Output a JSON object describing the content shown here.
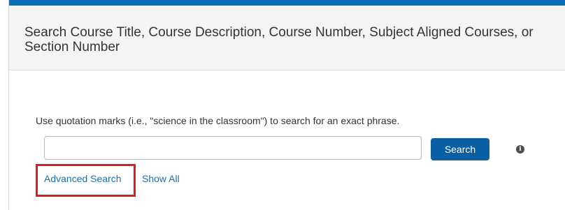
{
  "header": {
    "title": "Search Course Title, Course Description, Course Number, Subject Aligned Courses, or Section Number"
  },
  "search": {
    "hint": "Use quotation marks (i.e., \"science in the classroom\") to search for an exact phrase.",
    "value": "",
    "button_label": "Search",
    "info_icon": "i"
  },
  "links": {
    "advanced": "Advanced Search",
    "show_all": "Show All"
  },
  "colors": {
    "accent": "#0a6fb6",
    "button": "#0a5fa2",
    "link": "#1f6fb0",
    "highlight": "#e11b1b"
  }
}
